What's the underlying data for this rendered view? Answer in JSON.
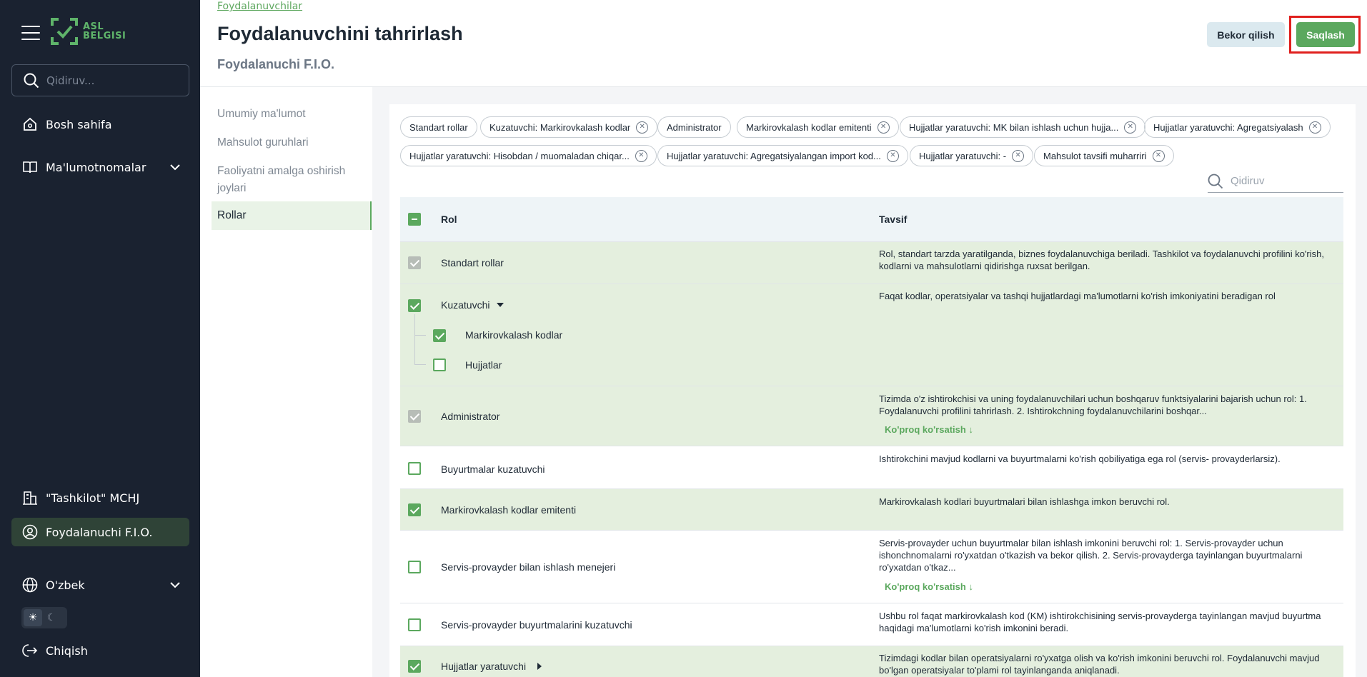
{
  "sidebar": {
    "logo_line1": "ASL",
    "logo_line2": "BELGISI",
    "search_placeholder": "Qidiruv...",
    "nav": {
      "home": "Bosh sahifa",
      "references": "Ma'lumotnomalar",
      "org": "\"Tashkilot\" MCHJ",
      "user": "Foydalanuchi F.I.O.",
      "language": "O'zbek",
      "logout": "Chiqish"
    }
  },
  "header": {
    "breadcrumb": "Foydalanuvchilar",
    "title": "Foydalanuvchini tahrirlash",
    "subtitle": "Foydalanuchi F.I.O.",
    "cancel_label": "Bekor qilish",
    "save_label": "Saqlash"
  },
  "tabs": {
    "general": "Umumiy ma'lumot",
    "product_groups": "Mahsulot guruhlari",
    "locations": "Faoliyatni amalga oshirish joylari",
    "roles": "Rollar"
  },
  "chips": [
    "Standart rollar",
    "Kuzatuvchi: Markirovkalash kodlar",
    "Administrator",
    "Markirovkalash kodlar emitenti",
    "Hujjatlar yaratuvchi: MK bilan ishlash uchun hujja...",
    "Hujjatlar yaratuvchi: Agregatsiyalash",
    "Hujjatlar yaratuvchi: Hisobdan / muomaladan chiqar...",
    "Hujjatlar yaratuvchi: Agregatsiyalangan import kod...",
    "Hujjatlar yaratuvchi: -",
    "Mahsulot tavsifi muharriri"
  ],
  "table": {
    "search_placeholder": "Qidiruv",
    "col_role": "Rol",
    "col_desc": "Tavsif",
    "more_label": "Ko'proq ko'rsatish",
    "rows": {
      "standard": {
        "name": "Standart rollar",
        "desc": "Rol, standart tarzda yaratilganda, biznes foydalanuvchiga beriladi. Tashkilot va foydalanuvchi profilini ko'rish, kodlarni va mahsulotlarni qidirishga ruxsat berilgan."
      },
      "observer": {
        "name": "Kuzatuvchi",
        "desc": "Faqat kodlar, operatsiyalar va tashqi hujjatlardagi ma'lumotlarni ko'rish imkoniyatini beradigan rol",
        "sub1": "Markirovkalash kodlar",
        "sub2": "Hujjatlar"
      },
      "admin": {
        "name": "Administrator",
        "desc": "Tizimda o'z ishtirokchisi va uning foydalanuvchilari uchun boshqaruv funktsiyalarini bajarish uchun rol: 1. Foydalanuvchi profilini tahrirlash. 2. Ishtirokchning foydalanuvchilarini boshqar..."
      },
      "orders_observer": {
        "name": "Buyurtmalar kuzatuvchi",
        "desc": "Ishtirokchini mavjud kodlarni va buyurtmalarni ko'rish qobiliyatiga ega rol (servis- provayderlarsiz)."
      },
      "issuer": {
        "name": "Markirovkalash kodlar emitenti",
        "desc": "Markirovkalash kodlari buyurtmalari bilan ishlashga imkon beruvchi rol."
      },
      "sp_manager": {
        "name": "Servis-provayder bilan ishlash menejeri",
        "desc": "Servis-provayder uchun buyurtmalar bilan ishlash imkonini beruvchi rol: 1. Servis-provayder uchun ishonchnomalarni ro'yxatdan o'tkazish va bekor qilish. 2. Servis-provayderga tayinlangan buyurtmalarni ro'yxatdan o'tkaz..."
      },
      "sp_observer": {
        "name": "Servis-provayder buyurtmalarini kuzatuvchi",
        "desc": "Ushbu rol faqat markirovkalash kod (KM) ishtirokchisining servis-provayderga tayinlangan mavjud buyurtma haqidagi ma'lumotlarni ko'rish imkonini beradi."
      },
      "doc_creator": {
        "name": "Hujjatlar yaratuvchi",
        "desc": "Tizimdagi kodlar bilan operatsiyalarni ro'yxatga olish va ko'rish imkonini beruvchi rol. Foydalanuvchi mavjud bo'lgan operatsiyalar to'plami rol tayinlanganda aniqlanadi."
      }
    }
  },
  "colors": {
    "accent": "#5ba85e",
    "sidebar_bg": "#1a2230",
    "selected_row": "#e4efde",
    "highlight": "#e0201e"
  }
}
